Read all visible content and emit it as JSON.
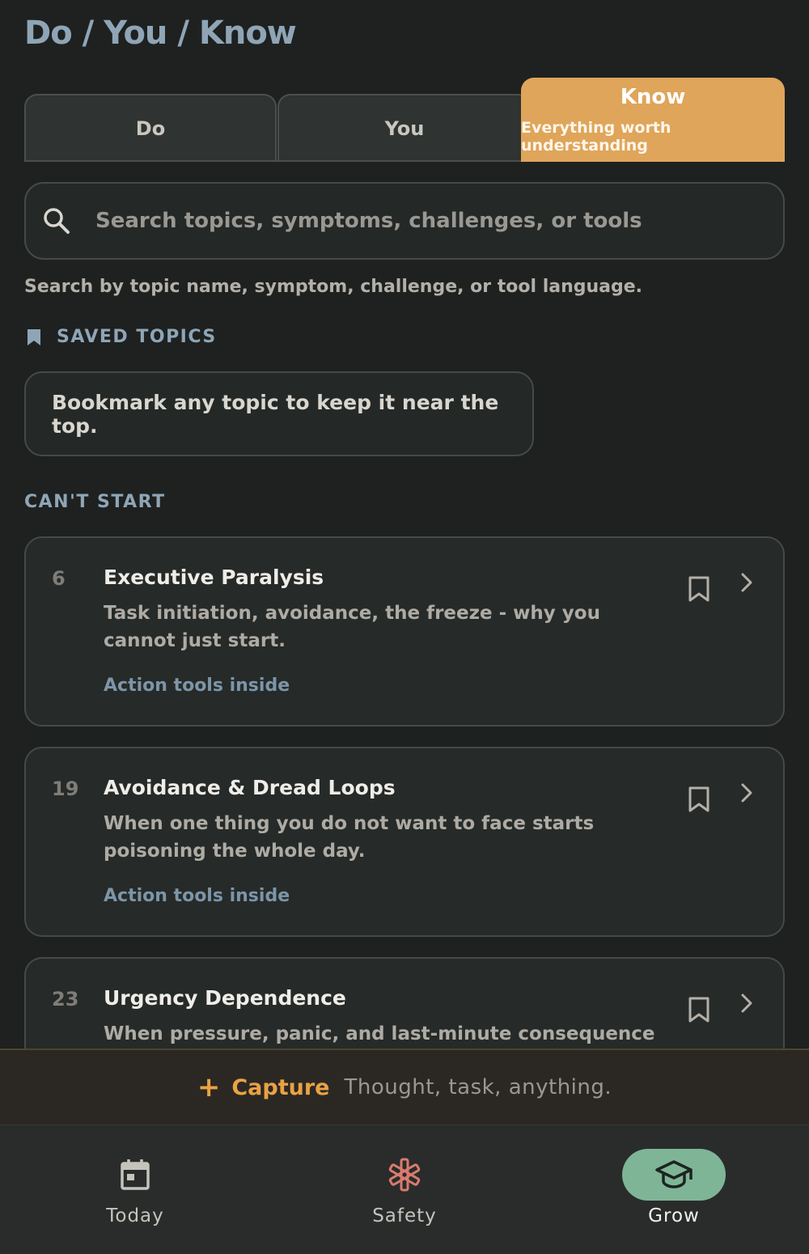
{
  "header": {
    "title": "Do / You / Know"
  },
  "tabs": [
    {
      "label": "Do"
    },
    {
      "label": "You"
    },
    {
      "label": "Know",
      "subtitle": "Everything worth understanding",
      "active": true
    }
  ],
  "search": {
    "placeholder": "Search topics, symptoms, challenges, or tools",
    "value": "",
    "hint": "Search by topic name, symptom, challenge, or tool language."
  },
  "saved": {
    "header": "SAVED TOPICS",
    "empty_text": "Bookmark any topic to keep it near the top."
  },
  "section": {
    "header": "CAN'T START"
  },
  "topics": [
    {
      "number": "6",
      "title": "Executive Paralysis",
      "description": "Task initiation, avoidance, the freeze - why you cannot just start.",
      "tag": "Action tools inside"
    },
    {
      "number": "19",
      "title": "Avoidance & Dread Loops",
      "description": "When one thing you do not want to face starts poisoning the whole day.",
      "tag": "Action tools inside"
    },
    {
      "number": "23",
      "title": "Urgency Dependence",
      "description": "When pressure, panic, and last-minute consequence feel",
      "tag": ""
    }
  ],
  "capture": {
    "label": "Capture",
    "placeholder": "Thought, task, anything."
  },
  "nav": [
    {
      "label": "Today",
      "icon": "calendar-icon"
    },
    {
      "label": "Safety",
      "icon": "asterisk-icon"
    },
    {
      "label": "Grow",
      "icon": "graduation-cap-icon",
      "active": true
    }
  ],
  "colors": {
    "accent": "#dfa55a",
    "background": "#1e2120",
    "heading_blue": "#8fa5b6",
    "safety_red": "#d97b6e",
    "grow_green": "#7fb597",
    "capture_orange": "#e9a245"
  }
}
